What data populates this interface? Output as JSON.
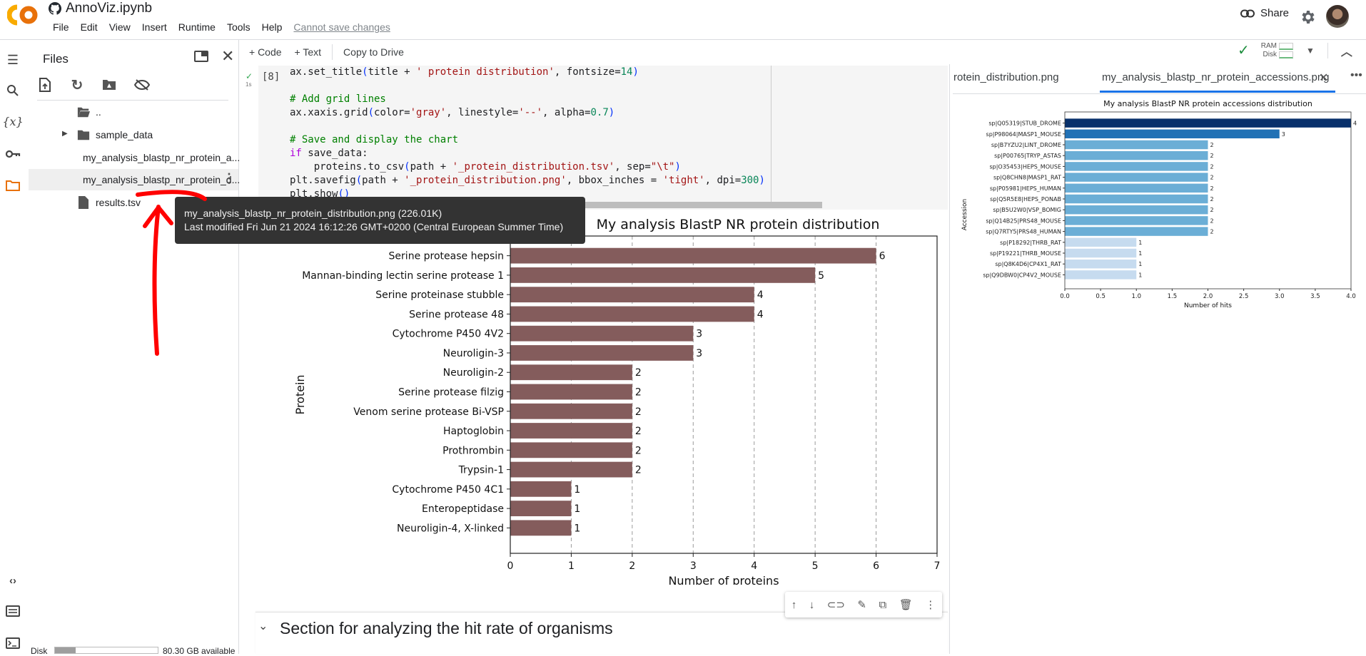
{
  "app": {
    "notebook_title": "AnnoViz.ipynb",
    "menu": [
      "File",
      "Edit",
      "View",
      "Insert",
      "Runtime",
      "Tools",
      "Help"
    ],
    "save_status": "Cannot save changes",
    "share_label": "Share"
  },
  "rail": {
    "icons": [
      "toc-icon",
      "search-icon",
      "variables-icon",
      "key-icon",
      "folder-icon",
      "code-snippets-icon",
      "command-palette-icon",
      "terminal-icon"
    ]
  },
  "files": {
    "title": "Files",
    "items": [
      {
        "name": "..",
        "type": "parent-folder"
      },
      {
        "name": "sample_data",
        "type": "folder"
      },
      {
        "name": "my_analysis_blastp_nr_protein_a...",
        "type": "file"
      },
      {
        "name": "my_analysis_blastp_nr_protein_d...",
        "type": "file",
        "selected": true
      },
      {
        "name": "results.tsv",
        "type": "file"
      }
    ],
    "disk_label": "Disk",
    "disk_available": "80.30 GB available",
    "disk_used_fraction": 0.2
  },
  "tooltip": {
    "line1": "my_analysis_blastp_nr_protein_distribution.png (226.01K)",
    "line2": "Last modified Fri Jun 21 2024 16:12:26 GMT+0200 (Central European Summer Time)"
  },
  "toolbar": {
    "code_label": "+ Code",
    "text_label": "+ Text",
    "copy_label": "Copy to Drive",
    "ram_label": "RAM",
    "disk_label": "Disk"
  },
  "cell": {
    "exec_count": "[8]",
    "runtime": "1s"
  },
  "section": {
    "title": "Section for analyzing the hit rate of organisms"
  },
  "right_panel": {
    "tabs": [
      {
        "label": "rotein_distribution.png",
        "active": false
      },
      {
        "label": "my_analysis_blastp_nr_protein_accessions.png",
        "active": true
      }
    ]
  },
  "chart_data": [
    {
      "type": "bar",
      "orientation": "horizontal",
      "title": "My analysis BlastP NR protein distribution",
      "xlabel": "Number of proteins",
      "ylabel": "Protein",
      "categories": [
        "Serine protease hepsin",
        "Mannan-binding lectin serine protease 1",
        "Serine proteinase stubble",
        "Serine protease 48",
        "Cytochrome P450 4V2",
        "Neuroligin-3",
        "Neuroligin-2",
        "Serine protease filzig",
        "Venom serine protease Bi-VSP",
        "Haptoglobin",
        "Prothrombin",
        "Trypsin-1",
        "Cytochrome P450 4C1",
        "Enteropeptidase",
        "Neuroligin-4, X-linked"
      ],
      "values": [
        6,
        5,
        4,
        4,
        3,
        3,
        2,
        2,
        2,
        2,
        2,
        2,
        1,
        1,
        1
      ],
      "xlim": [
        0,
        7
      ],
      "xticks": [
        0,
        1,
        2,
        3,
        4,
        5,
        6,
        7
      ],
      "grid": "x dashed",
      "bar_color": "#845c5c"
    },
    {
      "type": "bar",
      "orientation": "horizontal",
      "title": "My analysis BlastP NR protein accessions distribution",
      "xlabel": "Number of hits",
      "ylabel": "Accession",
      "categories": [
        "sp|Q05319|STUB_DROME",
        "sp|P98064|MASP1_MOUSE",
        "sp|B7YZU2|LINT_DROME",
        "sp|P00765|TRYP_ASTAS",
        "sp|O35453|HEPS_MOUSE",
        "sp|Q8CHN8|MASP1_RAT",
        "sp|P05981|HEPS_HUMAN",
        "sp|Q5R5E8|HEPS_PONAB",
        "sp|B5U2W0|VSP_BOMIG",
        "sp|Q14B25|PRS48_MOUSE",
        "sp|Q7RTY5|PRS48_HUMAN",
        "sp|P18292|THRB_RAT",
        "sp|P19221|THRB_MOUSE",
        "sp|Q8K4D6|CP4X1_RAT",
        "sp|Q9DBW0|CP4V2_MOUSE"
      ],
      "values": [
        4,
        3,
        2,
        2,
        2,
        2,
        2,
        2,
        2,
        2,
        2,
        1,
        1,
        1,
        1
      ],
      "xlim": [
        0,
        4
      ],
      "xticks": [
        "0.0",
        "0.5",
        "1.0",
        "1.5",
        "2.0",
        "2.5",
        "3.0",
        "3.5",
        "4.0"
      ],
      "grid": "none",
      "value_colors": {
        "4": "#08306b",
        "3": "#2171b5",
        "2": "#6baed6",
        "1": "#c6dbef"
      }
    }
  ]
}
